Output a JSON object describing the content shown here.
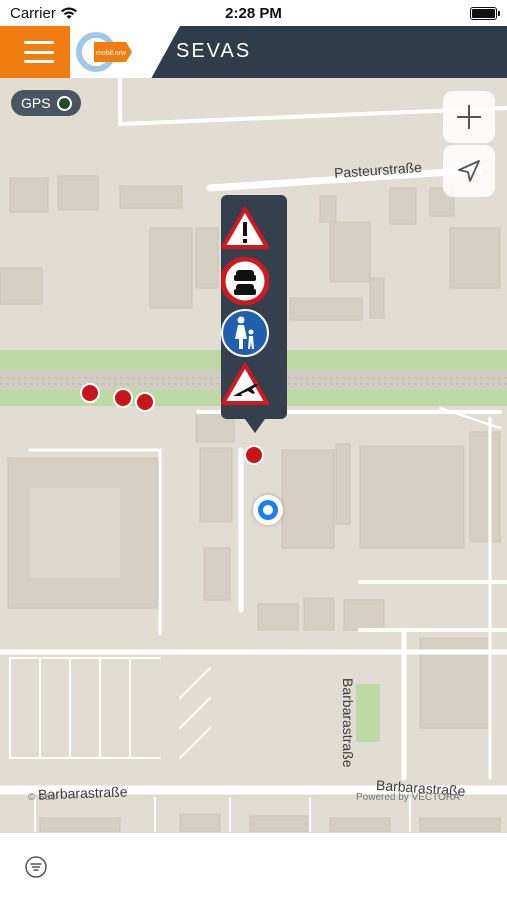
{
  "status_bar": {
    "carrier": "Carrier",
    "time": "2:28 PM"
  },
  "header": {
    "title": "SEVAS",
    "logo_text": "mobil.nrw",
    "accent_orange": "#ef7d10",
    "bar_color": "#2f3d4b"
  },
  "map": {
    "gps_label": "GPS",
    "streets": {
      "top": "Pasteurstraße",
      "right": "Barbarastraße",
      "bottom": "Barbarastraße"
    },
    "attribution": {
      "left": "© Sev",
      "right": "Powered by VECTORA"
    },
    "popup_signs": [
      "warning-sign",
      "no-overtaking-sign",
      "pedestrian-zone-sign",
      "aircraft-warning-sign"
    ],
    "poi_color": "#c8141b",
    "user_location_color": "#1a7ef2"
  },
  "controls": {
    "zoom_in_icon": "plus-icon",
    "locate_icon": "location-arrow-icon",
    "filter_icon": "filter-icon"
  }
}
